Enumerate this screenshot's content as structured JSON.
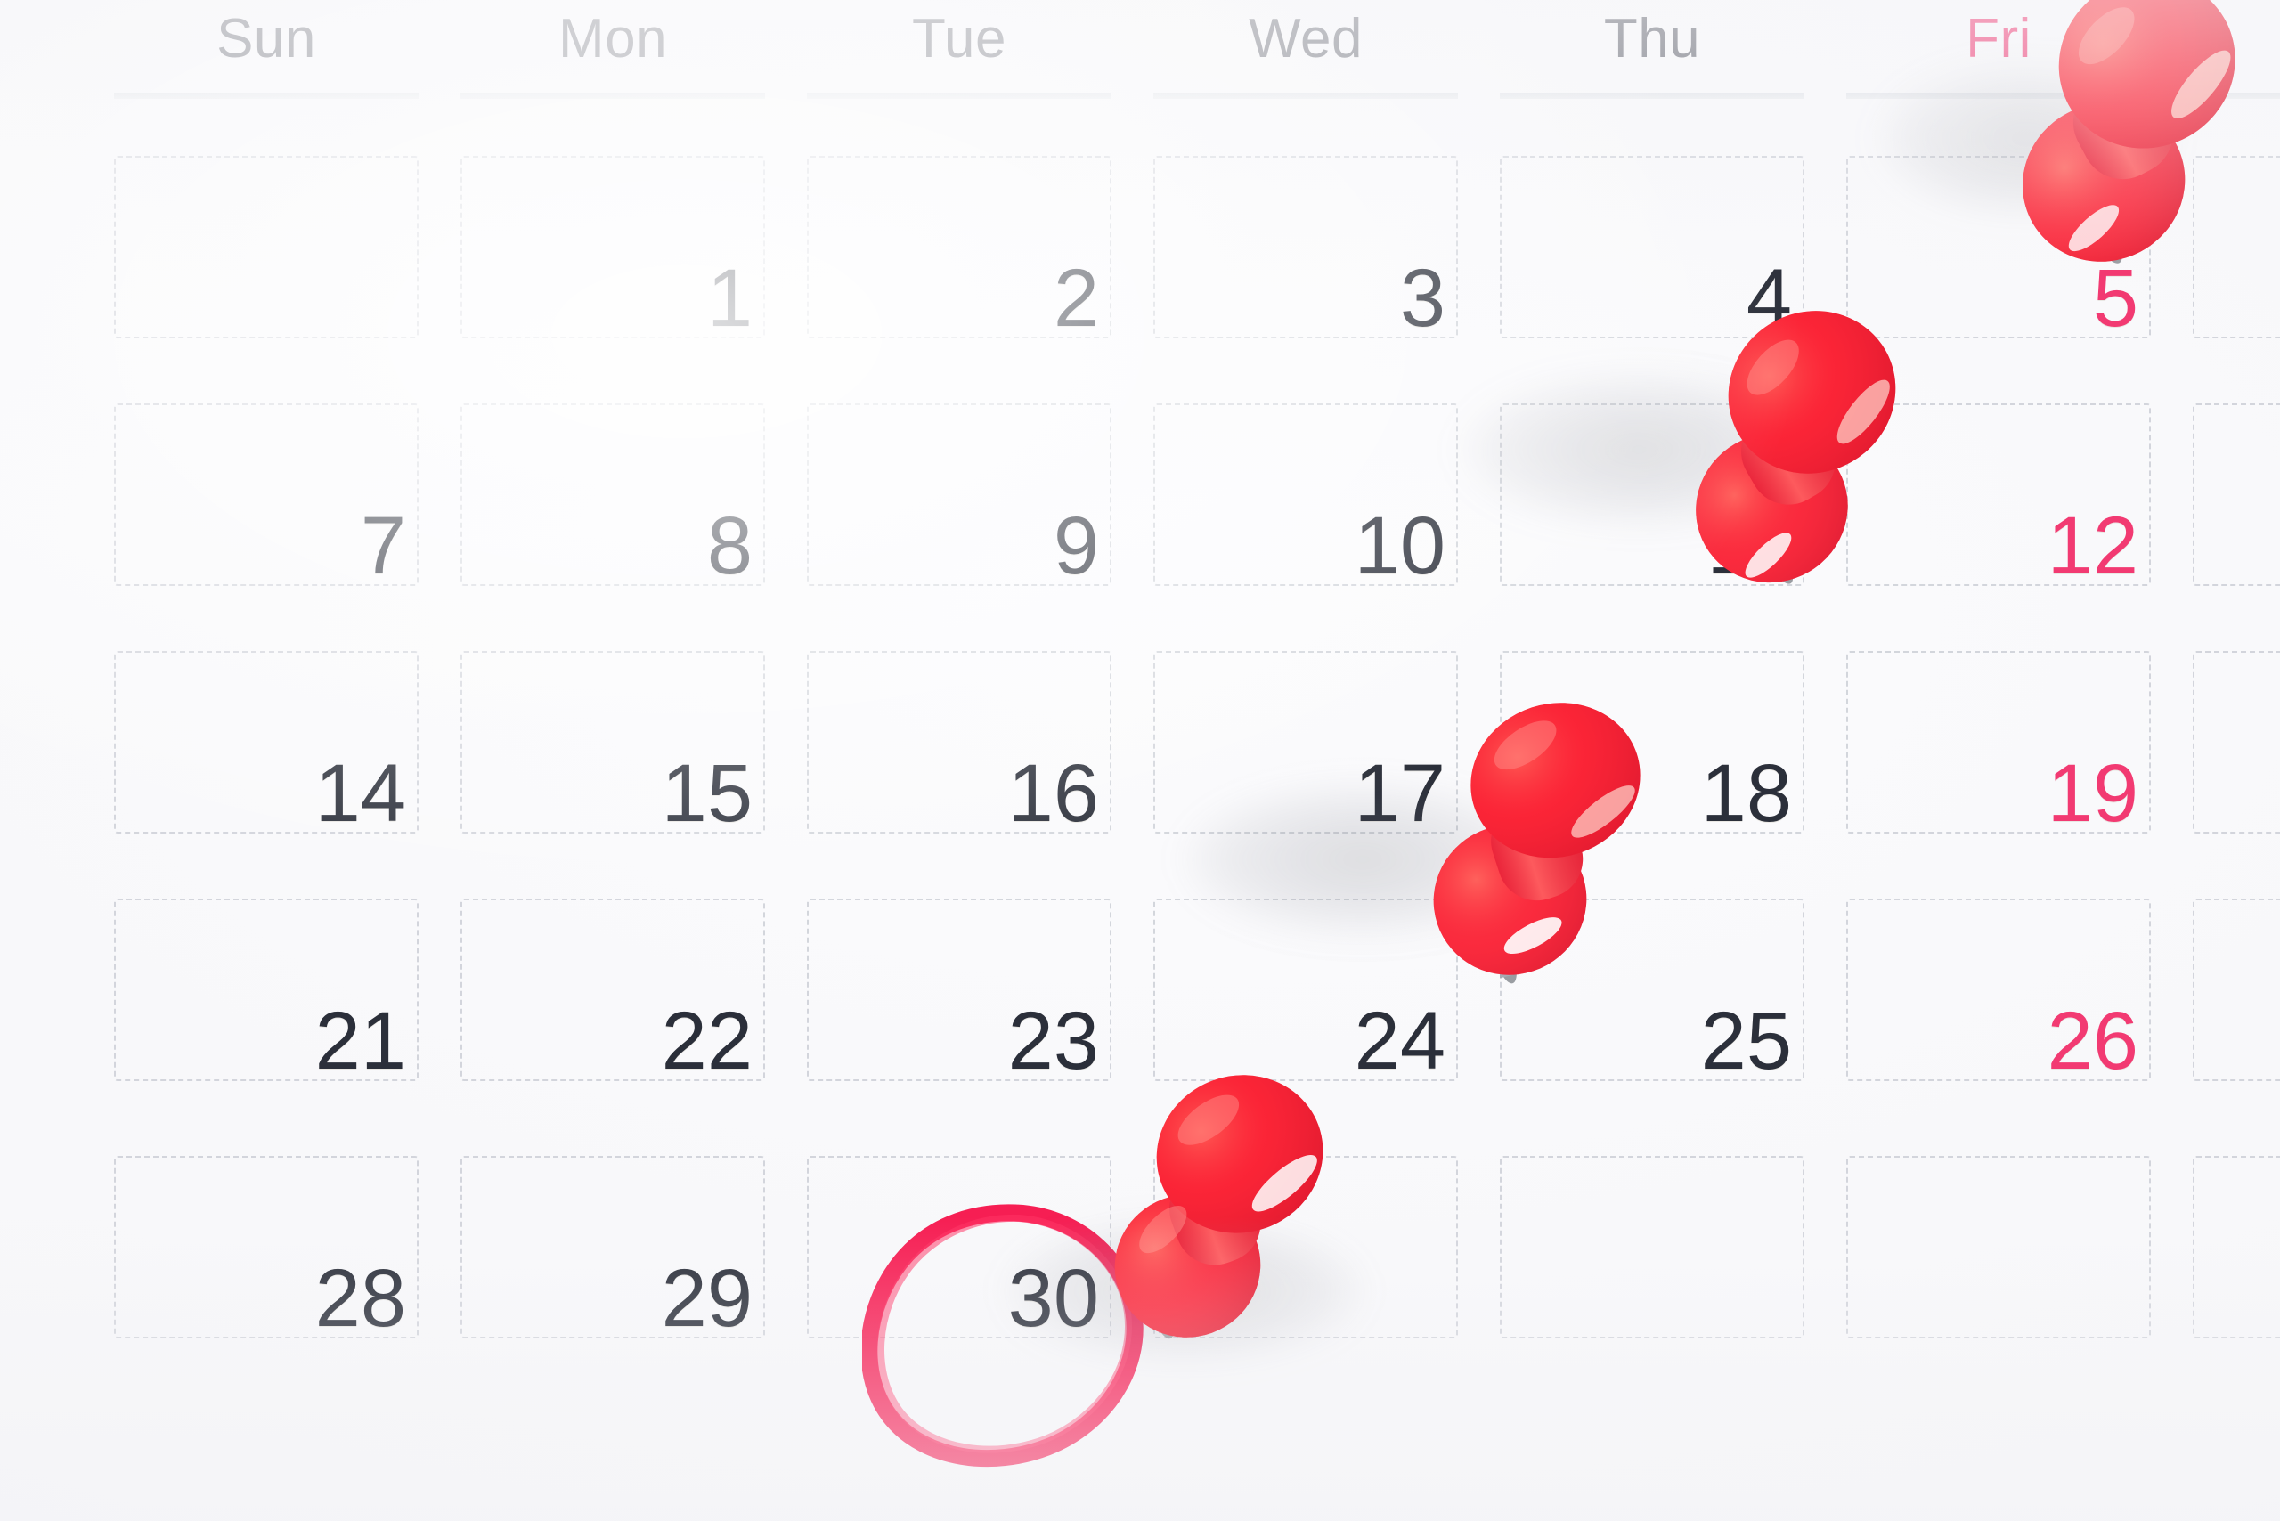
{
  "scene": {
    "kind": "photo-of-paper-calendar",
    "paper_color": "#f7f7f9",
    "grid_line_color": "#c9ccd4",
    "weekday_label_color": "#6e7079",
    "weekend_label_color": "#f0467c",
    "date_color": "#2b2f3a",
    "friday_date_color": "#f23a72",
    "pin_color": "#f8263a",
    "pin_highlight_color": "#ff6a6e",
    "marker_circle_color": "#f5124a"
  },
  "header": {
    "days": [
      {
        "label": "Sun",
        "accent": false
      },
      {
        "label": "Mon",
        "accent": false
      },
      {
        "label": "Tue",
        "accent": false
      },
      {
        "label": "Wed",
        "accent": false
      },
      {
        "label": "Thu",
        "accent": false
      },
      {
        "label": "Fri",
        "accent": true
      }
    ]
  },
  "grid": {
    "columns": 7,
    "rows": 5,
    "weeks": [
      {
        "cells": [
          {
            "date": "",
            "friday": false
          },
          {
            "date": "1",
            "friday": false
          },
          {
            "date": "2",
            "friday": false
          },
          {
            "date": "3",
            "friday": false
          },
          {
            "date": "4",
            "friday": false
          },
          {
            "date": "5",
            "friday": true
          },
          {
            "date": "",
            "friday": false
          }
        ]
      },
      {
        "cells": [
          {
            "date": "7",
            "friday": false
          },
          {
            "date": "8",
            "friday": false
          },
          {
            "date": "9",
            "friday": false
          },
          {
            "date": "10",
            "friday": false
          },
          {
            "date": "11",
            "friday": false
          },
          {
            "date": "12",
            "friday": true
          },
          {
            "date": "",
            "friday": false
          }
        ]
      },
      {
        "cells": [
          {
            "date": "14",
            "friday": false
          },
          {
            "date": "15",
            "friday": false
          },
          {
            "date": "16",
            "friday": false
          },
          {
            "date": "17",
            "friday": false
          },
          {
            "date": "18",
            "friday": false
          },
          {
            "date": "19",
            "friday": true
          },
          {
            "date": "",
            "friday": false
          }
        ]
      },
      {
        "cells": [
          {
            "date": "21",
            "friday": false
          },
          {
            "date": "22",
            "friday": false
          },
          {
            "date": "23",
            "friday": false
          },
          {
            "date": "24",
            "friday": false
          },
          {
            "date": "25",
            "friday": false
          },
          {
            "date": "26",
            "friday": true
          },
          {
            "date": "",
            "friday": false
          }
        ]
      },
      {
        "cells": [
          {
            "date": "28",
            "friday": false
          },
          {
            "date": "29",
            "friday": false
          },
          {
            "date": "30",
            "friday": false
          },
          {
            "date": "",
            "friday": false
          },
          {
            "date": "",
            "friday": false
          },
          {
            "date": "",
            "friday": false
          },
          {
            "date": "",
            "friday": false
          }
        ]
      }
    ]
  },
  "markings": {
    "circled_date": "30",
    "circle_label": "red-marker-circle-around-30",
    "pushpins": [
      {
        "id": "pin-near-5",
        "marks_date": "5",
        "label": "red-pushpin"
      },
      {
        "id": "pin-near-11",
        "marks_date": "11",
        "label": "red-pushpin"
      },
      {
        "id": "pin-near-17",
        "marks_date": "17",
        "label": "red-pushpin"
      },
      {
        "id": "pin-near-30",
        "marks_date": "30",
        "label": "red-pushpin"
      }
    ]
  }
}
